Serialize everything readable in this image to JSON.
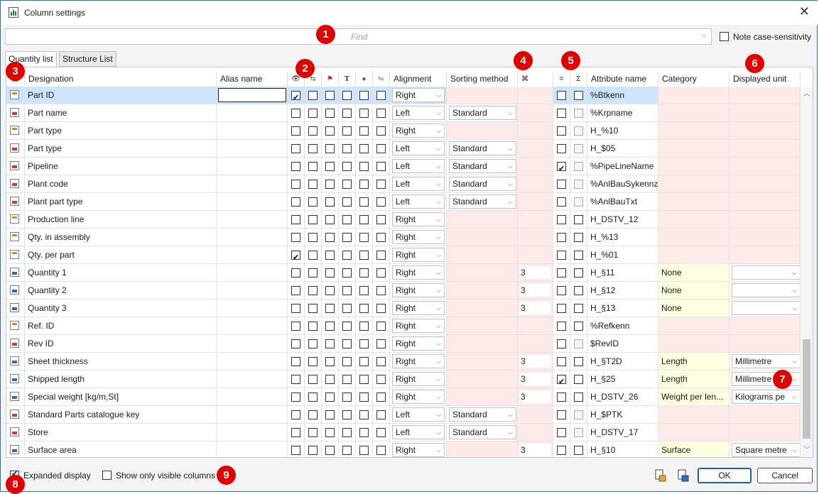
{
  "window": {
    "title": "Column settings"
  },
  "find": {
    "placeholder": "Find"
  },
  "note_case_sensitivity": {
    "label": "Note case-sensitivity",
    "checked": false
  },
  "tabs": [
    {
      "label": "Quantity list",
      "active": true
    },
    {
      "label": "Structure List",
      "active": false
    }
  ],
  "columns": {
    "designation": "Designation",
    "alias": "Alias name",
    "icon_cols": [
      "eye-icon",
      "arrow-icon",
      "flag-icon",
      "T",
      "globe-icon",
      "link-icon"
    ],
    "icon_glyphs": [
      "👁",
      "⇆",
      "⚑",
      "T",
      "●",
      "⇋"
    ],
    "alignment": "Alignment",
    "sorting": "Sorting method",
    "digits_glyph": "⌘",
    "equal_glyph": "=",
    "sum_glyph": "Σ",
    "attribute": "Attribute name",
    "category": "Category",
    "unit": "Displayed unit"
  },
  "rows": [
    {
      "icon": "gen",
      "name": "Part ID",
      "checks": [
        1,
        0,
        0,
        0,
        0,
        0
      ],
      "align": "Right",
      "sort": "",
      "digits": "",
      "eq": 0,
      "sum": 0,
      "sumgray": false,
      "attr": "%Btkenn",
      "cat": "",
      "unit": "",
      "sel": true
    },
    {
      "icon": "red",
      "name": "Part name",
      "checks": [
        0,
        0,
        0,
        0,
        0,
        0
      ],
      "align": "Left",
      "sort": "Standard",
      "digits": "",
      "eq": 0,
      "sum": 0,
      "sumgray": true,
      "attr": "%Krpname",
      "cat": "",
      "unit": ""
    },
    {
      "icon": "gen",
      "name": "Part type",
      "checks": [
        0,
        0,
        0,
        0,
        0,
        0
      ],
      "align": "Right",
      "sort": "",
      "digits": "",
      "eq": 0,
      "sum": 0,
      "sumgray": true,
      "attr": "H_%10",
      "cat": "",
      "unit": ""
    },
    {
      "icon": "red",
      "name": "Part type",
      "checks": [
        0,
        0,
        0,
        0,
        0,
        0
      ],
      "align": "Left",
      "sort": "Standard",
      "digits": "",
      "eq": 0,
      "sum": 0,
      "sumgray": true,
      "attr": "H_$05",
      "cat": "",
      "unit": ""
    },
    {
      "icon": "red",
      "name": "Pipeline",
      "checks": [
        0,
        0,
        0,
        0,
        0,
        0
      ],
      "align": "Left",
      "sort": "Standard",
      "digits": "",
      "eq": 1,
      "sum": 0,
      "sumgray": true,
      "attr": "%PipeLineName",
      "cat": "",
      "unit": ""
    },
    {
      "icon": "red",
      "name": "Plant code",
      "checks": [
        0,
        0,
        0,
        0,
        0,
        0
      ],
      "align": "Left",
      "sort": "Standard",
      "digits": "",
      "eq": 0,
      "sum": 0,
      "sumgray": true,
      "attr": "%AnlBauSykennz",
      "cat": "",
      "unit": ""
    },
    {
      "icon": "red",
      "name": "Plant part type",
      "checks": [
        0,
        0,
        0,
        0,
        0,
        0
      ],
      "align": "Left",
      "sort": "Standard",
      "digits": "",
      "eq": 0,
      "sum": 0,
      "sumgray": true,
      "attr": "%AnlBauTxt",
      "cat": "",
      "unit": ""
    },
    {
      "icon": "gen",
      "name": "Production line",
      "checks": [
        0,
        0,
        0,
        0,
        0,
        0
      ],
      "align": "Right",
      "sort": "",
      "digits": "",
      "eq": 0,
      "sum": 0,
      "sumgray": false,
      "attr": "H_DSTV_12",
      "cat": "",
      "unit": ""
    },
    {
      "icon": "gen",
      "name": "Qty. in assembly",
      "checks": [
        0,
        0,
        0,
        0,
        0,
        0
      ],
      "align": "Right",
      "sort": "",
      "digits": "",
      "eq": 0,
      "sum": 0,
      "sumgray": false,
      "attr": "H_%13",
      "cat": "",
      "unit": ""
    },
    {
      "icon": "gen",
      "name": "Qty. per part",
      "checks": [
        1,
        0,
        0,
        0,
        0,
        0
      ],
      "align": "Right",
      "sort": "",
      "digits": "",
      "eq": 0,
      "sum": 0,
      "sumgray": false,
      "attr": "H_%01",
      "cat": "",
      "unit": ""
    },
    {
      "icon": "blu",
      "name": "Quantity 1",
      "checks": [
        0,
        0,
        0,
        0,
        0,
        0
      ],
      "align": "Right",
      "sort": "",
      "digits": "3",
      "eq": 0,
      "sum": 0,
      "sumgray": false,
      "attr": "H_§11",
      "cat": "None",
      "unit": " "
    },
    {
      "icon": "blu",
      "name": "Quantity 2",
      "checks": [
        0,
        0,
        0,
        0,
        0,
        0
      ],
      "align": "Right",
      "sort": "",
      "digits": "3",
      "eq": 0,
      "sum": 0,
      "sumgray": false,
      "attr": "H_§12",
      "cat": "None",
      "unit": " "
    },
    {
      "icon": "blu",
      "name": "Quantity 3",
      "checks": [
        0,
        0,
        0,
        0,
        0,
        0
      ],
      "align": "Right",
      "sort": "",
      "digits": "3",
      "eq": 0,
      "sum": 0,
      "sumgray": false,
      "attr": "H_§13",
      "cat": "None",
      "unit": " "
    },
    {
      "icon": "gen",
      "name": "Ref. ID",
      "checks": [
        0,
        0,
        0,
        0,
        0,
        0
      ],
      "align": "Right",
      "sort": "",
      "digits": "",
      "eq": 0,
      "sum": 0,
      "sumgray": false,
      "attr": "%Refkenn",
      "cat": "",
      "unit": ""
    },
    {
      "icon": "red",
      "name": "Rev ID",
      "checks": [
        0,
        0,
        0,
        0,
        0,
        0
      ],
      "align": "Right",
      "sort": "",
      "digits": "",
      "eq": 0,
      "sum": 0,
      "sumgray": true,
      "attr": "$RevID",
      "cat": "",
      "unit": ""
    },
    {
      "icon": "blu",
      "name": "Sheet thickness",
      "checks": [
        0,
        0,
        0,
        0,
        0,
        0
      ],
      "align": "Right",
      "sort": "",
      "digits": "3",
      "eq": 0,
      "sum": 0,
      "sumgray": false,
      "attr": "H_§T2D",
      "cat": "Length",
      "unit": "Millimetre"
    },
    {
      "icon": "blu",
      "name": "Shipped length",
      "checks": [
        0,
        0,
        0,
        0,
        0,
        0
      ],
      "align": "Right",
      "sort": "",
      "digits": "3",
      "eq": 1,
      "sum": 0,
      "sumgray": false,
      "attr": "H_§25",
      "cat": "Length",
      "unit": "Millimetre"
    },
    {
      "icon": "blu",
      "name": "Special weight [kg/m,St]",
      "checks": [
        0,
        0,
        0,
        0,
        0,
        0
      ],
      "align": "Right",
      "sort": "",
      "digits": "3",
      "eq": 0,
      "sum": 0,
      "sumgray": false,
      "attr": "H_DSTV_26",
      "cat": "Weight per len...",
      "unit": "Kilograms pe"
    },
    {
      "icon": "red",
      "name": "Standard Parts catalogue key",
      "checks": [
        0,
        0,
        0,
        0,
        0,
        0
      ],
      "align": "Left",
      "sort": "Standard",
      "digits": "",
      "eq": 0,
      "sum": 0,
      "sumgray": true,
      "attr": "H_$PTK",
      "cat": "",
      "unit": ""
    },
    {
      "icon": "red",
      "name": "Store",
      "checks": [
        0,
        0,
        0,
        0,
        0,
        0
      ],
      "align": "Left",
      "sort": "Standard",
      "digits": "",
      "eq": 0,
      "sum": 0,
      "sumgray": true,
      "attr": "H_DSTV_17",
      "cat": "",
      "unit": ""
    },
    {
      "icon": "blu",
      "name": "Surface area",
      "checks": [
        0,
        0,
        0,
        0,
        0,
        0
      ],
      "align": "Right",
      "sort": "",
      "digits": "3",
      "eq": 0,
      "sum": 0,
      "sumgray": false,
      "attr": "H_§10",
      "cat": "Surface",
      "unit": "Square metre"
    }
  ],
  "footer": {
    "expanded_display": {
      "label": "Expanded display",
      "checked": true
    },
    "show_visible": {
      "label": "Show only visible columns",
      "checked": false
    },
    "ok": "OK",
    "cancel": "Cancel"
  },
  "badges": [
    "1",
    "2",
    "3",
    "4",
    "5",
    "6",
    "7",
    "8",
    "9"
  ],
  "colors": {
    "badge": "#e00000",
    "selection": "#cde4fa",
    "pink": "#fde8ea",
    "yellow": "#fdfde0",
    "accent": "#1f5fa8"
  }
}
